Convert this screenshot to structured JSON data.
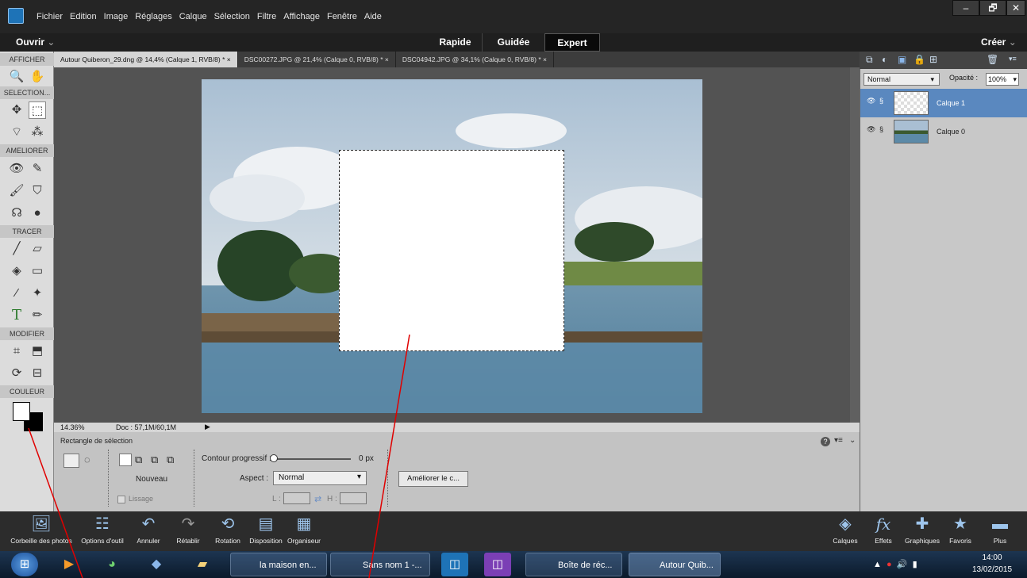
{
  "menu": [
    "Fichier",
    "Edition",
    "Image",
    "Réglages",
    "Calque",
    "Sélection",
    "Filtre",
    "Affichage",
    "Fenêtre",
    "Aide"
  ],
  "window_buttons": [
    "–",
    "🗗",
    "✕"
  ],
  "modebar": {
    "open": "Ouvrir",
    "rapide": "Rapide",
    "guidee": "Guidée",
    "expert": "Expert",
    "create": "Créer",
    "dropdown_glyph": "⌄"
  },
  "toolbox": {
    "sections": [
      "AFFICHER",
      "SELECTION...",
      "AMELIORER",
      "TRACER",
      "MODIFIER",
      "COULEUR"
    ]
  },
  "tabs": [
    "Autour Quiberon_29.dng @ 14,4% (Calque 1, RVB/8) *  ×",
    "DSC00272.JPG @ 21,4% (Calque 0, RVB/8) *  ×",
    "DSC04942.JPG @ 34,1% (Calque 0, RVB/8) *  ×"
  ],
  "status": {
    "zoom": "14.36%",
    "doc": "Doc : 57,1M/60,1M"
  },
  "options": {
    "title": "Rectangle de sélection",
    "mode": "Nouveau",
    "lissage": "Lissage",
    "contour_label": "Contour progressif :",
    "contour_value": "0 px",
    "aspect_label": "Aspect :",
    "aspect_value": "Normal",
    "l_label": "L :",
    "h_label": "H :",
    "improve_btn": "Améliorer le c...",
    "help_glyph": "?"
  },
  "layers": {
    "blend": "Normal",
    "opacity_label": "Opacité :",
    "opacity_value": "100%",
    "items": [
      {
        "name": "Calque 1",
        "selected": true
      },
      {
        "name": "Calque 0",
        "selected": false
      }
    ]
  },
  "bottombar": {
    "left": [
      "Corbeille des photos",
      "Options d'outil",
      "Annuler",
      "Rétablir",
      "Rotation",
      "Disposition",
      "Organiseur"
    ],
    "right": [
      "Calques",
      "Effets",
      "Graphiques",
      "Favoris",
      "Plus"
    ]
  },
  "taskbar": {
    "items": [
      "la maison en...",
      "Sans nom 1 -...",
      "Boîte de réc...",
      "Autour Quib..."
    ],
    "time": "14:00",
    "date": "13/02/2015"
  }
}
